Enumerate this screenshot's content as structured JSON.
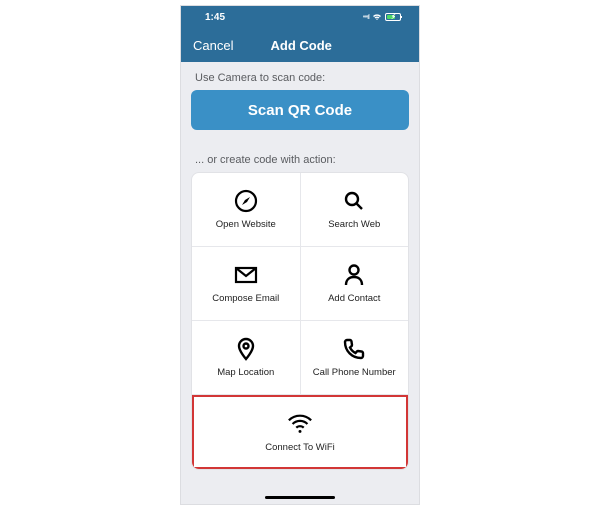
{
  "status": {
    "time": "1:45",
    "signal": "....",
    "wifi": "⧋"
  },
  "nav": {
    "cancel": "Cancel",
    "title": "Add Code"
  },
  "section": {
    "scan_label": "Use Camera to scan code:",
    "scan_button": "Scan QR Code",
    "create_label": "... or create code with action:"
  },
  "tiles": {
    "open_website": "Open Website",
    "search_web": "Search Web",
    "compose_email": "Compose Email",
    "add_contact": "Add Contact",
    "map_location": "Map Location",
    "call_phone": "Call Phone Number",
    "connect_wifi": "Connect To WiFi"
  }
}
